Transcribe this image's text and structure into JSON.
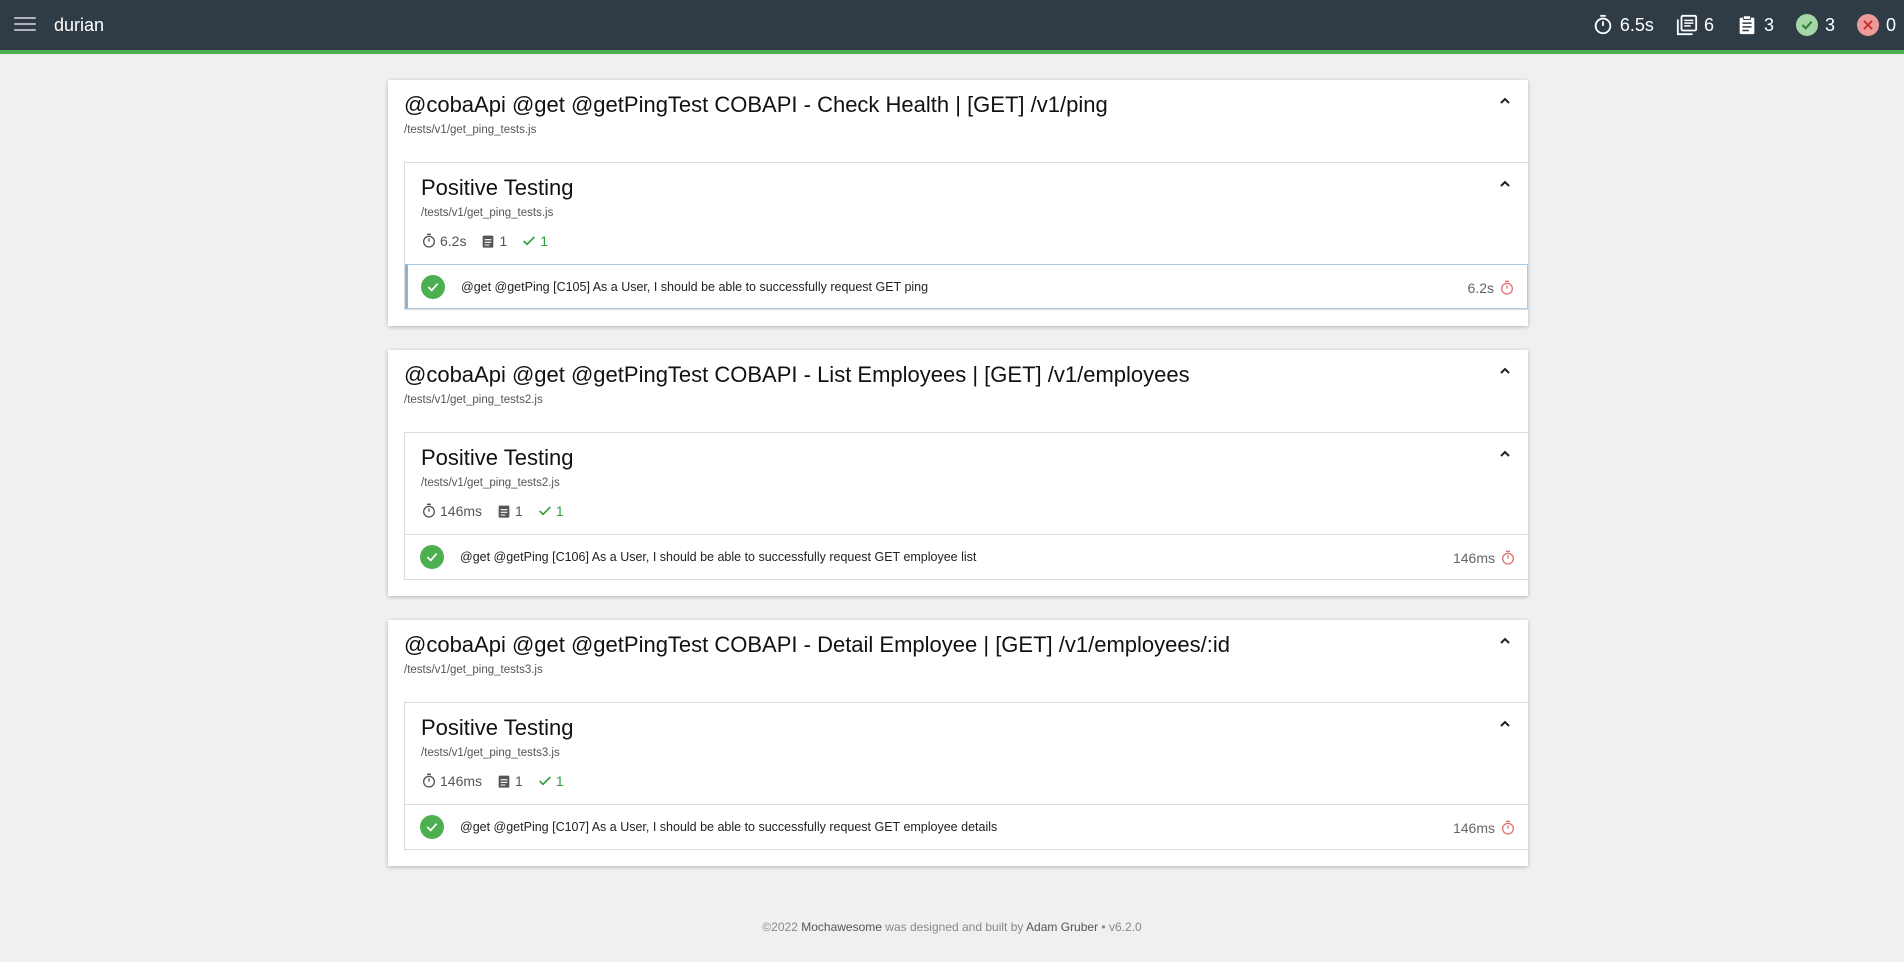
{
  "header": {
    "title": "durian",
    "stats": {
      "duration": "6.5s",
      "suites": "6",
      "tests": "3",
      "passes": "3",
      "failures": "0"
    }
  },
  "suites": [
    {
      "title": "@cobaApi @get @getPingTest COBAPI - Check Health | [GET] /v1/ping",
      "file": "/tests/v1/get_ping_tests.js",
      "inner": {
        "title": "Positive Testing",
        "file": "/tests/v1/get_ping_tests.js",
        "duration": "6.2s",
        "tests": "1",
        "passes": "1",
        "test": {
          "title": "@get @getPing [C105] As a User, I should be able to successfully request GET ping",
          "duration": "6.2s"
        }
      }
    },
    {
      "title": "@cobaApi @get @getPingTest COBAPI - List Employees | [GET] /v1/employees",
      "file": "/tests/v1/get_ping_tests2.js",
      "inner": {
        "title": "Positive Testing",
        "file": "/tests/v1/get_ping_tests2.js",
        "duration": "146ms",
        "tests": "1",
        "passes": "1",
        "test": {
          "title": "@get @getPing [C106] As a User, I should be able to successfully request GET employee list",
          "duration": "146ms"
        }
      }
    },
    {
      "title": "@cobaApi @get @getPingTest COBAPI - Detail Employee | [GET] /v1/employees/:id",
      "file": "/tests/v1/get_ping_tests3.js",
      "inner": {
        "title": "Positive Testing",
        "file": "/tests/v1/get_ping_tests3.js",
        "duration": "146ms",
        "tests": "1",
        "passes": "1",
        "test": {
          "title": "@get @getPing [C107] As a User, I should be able to successfully request GET employee details",
          "duration": "146ms"
        }
      }
    }
  ],
  "footer": {
    "copyright": "©2022",
    "product": "Mochawesome",
    "middle": "was designed and built by",
    "author": "Adam Gruber",
    "version": "• v6.2.0"
  },
  "colors": {
    "topbar": "#2f3c46",
    "accent": "#4caf50",
    "fail": "#ef9a9a",
    "duration_icon": "#e57373"
  },
  "icons": [
    "menu-icon",
    "timer-icon",
    "suites-icon",
    "tests-icon",
    "check-icon",
    "close-icon",
    "chevron-up-icon"
  ]
}
